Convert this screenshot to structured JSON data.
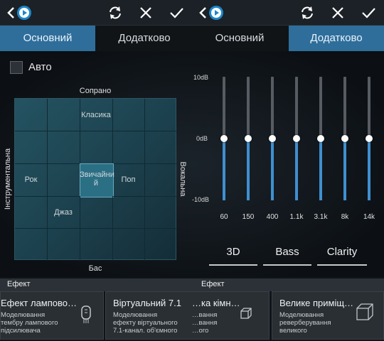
{
  "app": {
    "left": {
      "tabs": [
        "Основний",
        "Додатково"
      ],
      "active_tab": 0,
      "auto_label": "Авто",
      "grid": {
        "top_axis": "Сопрано",
        "bottom_axis": "Бас",
        "left_axis": "Інструментальна",
        "right_axis": "Вокальна",
        "labels": {
          "classic": "Класика",
          "rock": "Рок",
          "normal": "Звичайни\nй",
          "pop": "Поп",
          "jazz": "Джаз"
        },
        "selected": "normal"
      }
    },
    "right": {
      "tabs": [
        "Основний",
        "Додатково"
      ],
      "active_tab": 1,
      "eq": {
        "top_label": "10dB",
        "mid_label": "0dB",
        "bottom_label": "-10dB",
        "bands": [
          {
            "freq": "60",
            "value_db": 0
          },
          {
            "freq": "150",
            "value_db": 0
          },
          {
            "freq": "400",
            "value_db": 0
          },
          {
            "freq": "1.1k",
            "value_db": 0
          },
          {
            "freq": "3.1k",
            "value_db": 0
          },
          {
            "freq": "8k",
            "value_db": 0
          },
          {
            "freq": "14k",
            "value_db": 0
          }
        ]
      },
      "presets": [
        "3D",
        "Bass",
        "Clarity"
      ]
    },
    "effects": {
      "header_left": "Ефект",
      "header_right": "Ефект",
      "cards": [
        {
          "title": "Ефект лампово…",
          "desc": "Моделювання\nтембру лампового\nпідсилювача",
          "icon": "tube-icon"
        },
        {
          "title": "Віртуальний 7.1",
          "desc": "Моделювання\nефекту віртуального\n7.1-канал. об'ємного",
          "icon": "cube-icon"
        },
        {
          "title": "…ка кімн…",
          "desc": "…вання\n…вання\n…ого",
          "icon": "cube-icon"
        },
        {
          "title": "Велике приміщ…",
          "desc": "Моделювання\nреверберування\nвеликого",
          "icon": "cube-large-icon"
        }
      ]
    }
  },
  "colors": {
    "accent": "#2f6e9a",
    "eq_fill": "#3f8fd1",
    "grid_tile": "#245361"
  }
}
